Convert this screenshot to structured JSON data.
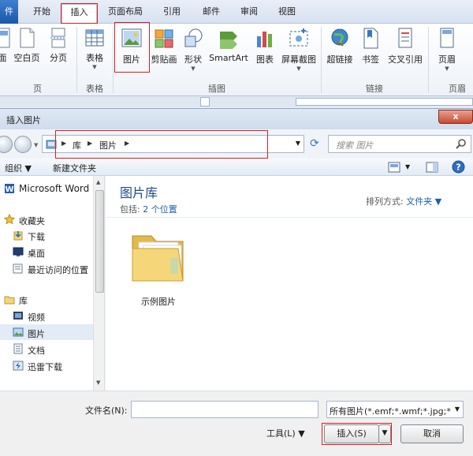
{
  "ribbon": {
    "tabs": [
      {
        "label": "件"
      },
      {
        "label": "开始"
      },
      {
        "label": "插入"
      },
      {
        "label": "页面布局"
      },
      {
        "label": "引用"
      },
      {
        "label": "邮件"
      },
      {
        "label": "审阅"
      },
      {
        "label": "视图"
      }
    ],
    "buttons": {
      "cover": "面",
      "blank_page": "空白页",
      "page_break": "分页",
      "table": "表格",
      "picture": "图片",
      "clipart": "剪贴画",
      "shapes": "形状",
      "smartart": "SmartArt",
      "chart": "图表",
      "screenshot": "屏幕截图",
      "hyperlink": "超链接",
      "bookmark": "书签",
      "cross_ref": "交叉引用",
      "header": "页眉"
    },
    "groups": {
      "pages": "页",
      "tables": "表格",
      "illustrations": "插图",
      "links": "链接",
      "header_footer": "页眉"
    }
  },
  "dialog": {
    "title": "插入图片",
    "close": "x",
    "breadcrumb": [
      "库",
      "图片"
    ],
    "search_placeholder": "搜索 图片",
    "toolbar": {
      "organize": "组织 ▼",
      "new_folder": "新建文件夹"
    },
    "sidebar": [
      {
        "label": "Microsoft Word",
        "icon": "word-icon"
      },
      {
        "label": "收藏夹",
        "icon": "star-icon"
      },
      {
        "label": "下载",
        "icon": "download-icon"
      },
      {
        "label": "桌面",
        "icon": "desktop-icon"
      },
      {
        "label": "最近访问的位置",
        "icon": "recent-icon"
      },
      {
        "label": "库",
        "icon": "library-icon"
      },
      {
        "label": "视频",
        "icon": "video-icon"
      },
      {
        "label": "图片",
        "icon": "picture-icon"
      },
      {
        "label": "文档",
        "icon": "document-icon"
      },
      {
        "label": "迅雷下载",
        "icon": "thunder-icon"
      }
    ],
    "content": {
      "title": "图片库",
      "includes_label": "包括:",
      "includes_value": "2 个位置",
      "sort_label": "排列方式:",
      "sort_value": "文件夹 ▼",
      "folder_name": "示例图片"
    },
    "bottom": {
      "filename_label": "文件名(N):",
      "filename_value": "",
      "filetype_value": "所有图片(*.emf;*.wmf;*.jpg;*.jpeg;*.png)",
      "tools_label": "工具(L)  ▼",
      "insert_label": "插入(S)",
      "cancel_label": "取消"
    }
  }
}
